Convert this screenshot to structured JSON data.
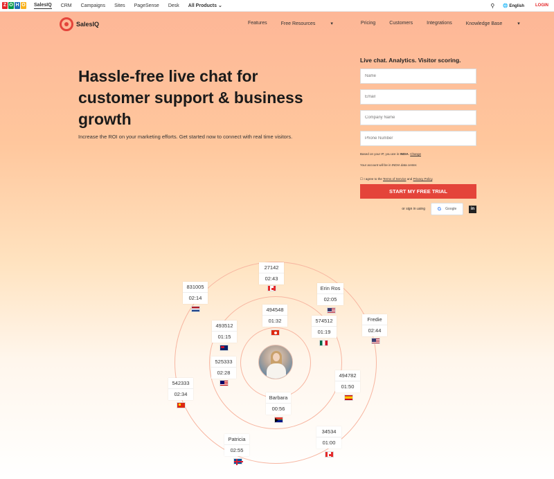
{
  "topbar": {
    "logo_letters": [
      "Z",
      "O",
      "H",
      "O"
    ],
    "logo_colors": [
      "#e42527",
      "#089949",
      "#226db4",
      "#f9b21d"
    ],
    "products": [
      "SalesIQ",
      "CRM",
      "Campaigns",
      "Sites",
      "PageSense",
      "Desk"
    ],
    "all_products": "All Products",
    "language": "English",
    "login": "LOGIN"
  },
  "nav": {
    "brand": "SalesIQ",
    "items": [
      "Features",
      "Free Resources",
      "Pricing",
      "Customers",
      "Integrations",
      "Knowledge Base"
    ]
  },
  "hero": {
    "title": "Hassle-free live chat for customer support & business growth",
    "subtitle": "Increase the ROI on your marketing efforts. Get started now to connect with real time visitors."
  },
  "form": {
    "title": "Live chat. Analytics. Visitor scoring.",
    "name_placeholder": "Name",
    "email_placeholder": "Email",
    "company_placeholder": "Company Name",
    "phone_placeholder": "Phone Number",
    "ip_note_pre": "Based on your IP, you are in",
    "ip_country": "INDIA",
    "ip_change": "Change",
    "dc_note": "Your account will be in INDIA data center.",
    "agree_pre": "I agree to the",
    "terms": "Terms of Service",
    "agree_and": "and",
    "privacy": "Privacy Policy",
    "cta": "START MY FREE TRIAL",
    "signin_label": "or sign in using",
    "google": "Google"
  },
  "visitors": [
    {
      "l1": "27142",
      "l2": "02:43",
      "flag": "ca"
    },
    {
      "l1": "831005",
      "l2": "02:14",
      "flag": "nl"
    },
    {
      "l1": "Erin Ros",
      "l2": "02:05",
      "flag": "us"
    },
    {
      "l1": "494548",
      "l2": "01:32",
      "flag": "hk"
    },
    {
      "l1": "574512",
      "l2": "01:19",
      "flag": "mx"
    },
    {
      "l1": "493512",
      "l2": "01:15",
      "flag": "au"
    },
    {
      "l1": "Fredie",
      "l2": "02:44",
      "flag": "us"
    },
    {
      "l1": "525333",
      "l2": "02:28",
      "flag": "my"
    },
    {
      "l1": "494782",
      "l2": "01:50",
      "flag": "es"
    },
    {
      "l1": "542333",
      "l2": "02:34",
      "flag": "cn"
    },
    {
      "l1": "Barbara",
      "l2": "00:56",
      "flag": "za"
    },
    {
      "l1": "Patricia",
      "l2": "02:55",
      "flag": "is"
    },
    {
      "l1": "34534",
      "l2": "01:00",
      "flag": "ca"
    }
  ]
}
